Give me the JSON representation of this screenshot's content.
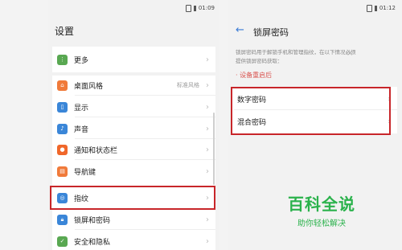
{
  "left": {
    "time": "01:09",
    "title": "设置",
    "items": [
      {
        "label": "更多",
        "icon": "more-icon",
        "color": "#59a852"
      },
      {
        "label": "桌面风格",
        "value": "标准风格",
        "icon": "home-icon",
        "color": "#f07a3a"
      },
      {
        "label": "显示",
        "icon": "display-icon",
        "color": "#3a86d8"
      },
      {
        "label": "声音",
        "icon": "sound-icon",
        "color": "#3a86d8"
      },
      {
        "label": "通知和状态栏",
        "icon": "bell-icon",
        "color": "#f0672a"
      },
      {
        "label": "导航键",
        "icon": "nav-key-icon",
        "color": "#f07a3a"
      },
      {
        "label": "指纹",
        "icon": "fingerprint-icon",
        "color": "#3a86d8"
      },
      {
        "label": "锁屏和密码",
        "icon": "lock-icon",
        "color": "#3a86d8"
      },
      {
        "label": "安全和隐私",
        "icon": "shield-icon",
        "color": "#59a852"
      }
    ]
  },
  "right": {
    "time": "01:12",
    "title": "锁屏密码",
    "description": "锁屏密码用于解锁手机和管理指纹，在以下情况必须提供锁屏密码获取：",
    "link": "· 设备重启后",
    "options": [
      {
        "label": "数字密码"
      },
      {
        "label": "混合密码"
      }
    ]
  },
  "watermark": {
    "title": "百科全说",
    "subtitle": "助你轻松解决"
  },
  "colors": {
    "highlight": "#c8262a",
    "accent": "#3a7bd5",
    "watermark": "#2bb24c"
  }
}
